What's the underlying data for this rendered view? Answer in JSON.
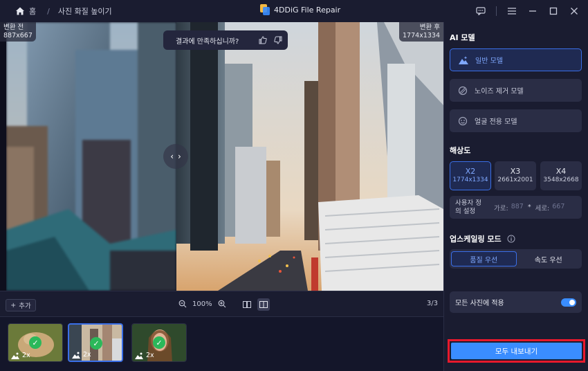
{
  "titlebar": {
    "home_label": "홈",
    "breadcrumb": "사진 화질 높이기",
    "app_title": "4DDiG File Repair"
  },
  "preview": {
    "before_label": "변환 전",
    "before_size": "887x667",
    "after_label": "변환 후",
    "after_size": "1774x1334",
    "feedback_question": "결과에 만족하십니까?",
    "compare_left": "‹",
    "compare_right": "›"
  },
  "toolbar": {
    "add_label": "추가",
    "zoom": "100%",
    "page": "3/3"
  },
  "thumbnails": [
    {
      "scale": "2x",
      "selected": false
    },
    {
      "scale": "2x",
      "selected": true
    },
    {
      "scale": "2x",
      "selected": false
    }
  ],
  "panel": {
    "ai_model_title": "AI 모델",
    "models": [
      {
        "label": "일반 모델",
        "icon": "landscape-icon",
        "active": true
      },
      {
        "label": "노이즈 제거 모델",
        "icon": "denoise-icon",
        "active": false
      },
      {
        "label": "얼굴 전용 모델",
        "icon": "face-icon",
        "active": false
      }
    ],
    "resolution_title": "해상도",
    "resolutions": [
      {
        "scale": "X2",
        "size": "1774x1334",
        "active": true
      },
      {
        "scale": "X3",
        "size": "2661x2001",
        "active": false
      },
      {
        "scale": "X4",
        "size": "3548x2668",
        "active": false
      }
    ],
    "custom_label_1": "사용자 정",
    "custom_label_2": "의 설정",
    "width_label": "가로:",
    "width_value": "887",
    "multiply": "*",
    "height_label": "세로:",
    "height_value": "667",
    "upscale_mode_title": "업스케일링 모드",
    "modes": [
      {
        "label": "품질 우선",
        "active": true
      },
      {
        "label": "속도 우선",
        "active": false
      }
    ],
    "apply_all_label": "모든 사진에 적용",
    "apply_all_on": true,
    "export_label": "모두 내보내기"
  },
  "colors": {
    "accent": "#3a8dff",
    "active_border": "#3a6fe8",
    "highlight_frame": "#e8192c",
    "success": "#2bb85a"
  }
}
